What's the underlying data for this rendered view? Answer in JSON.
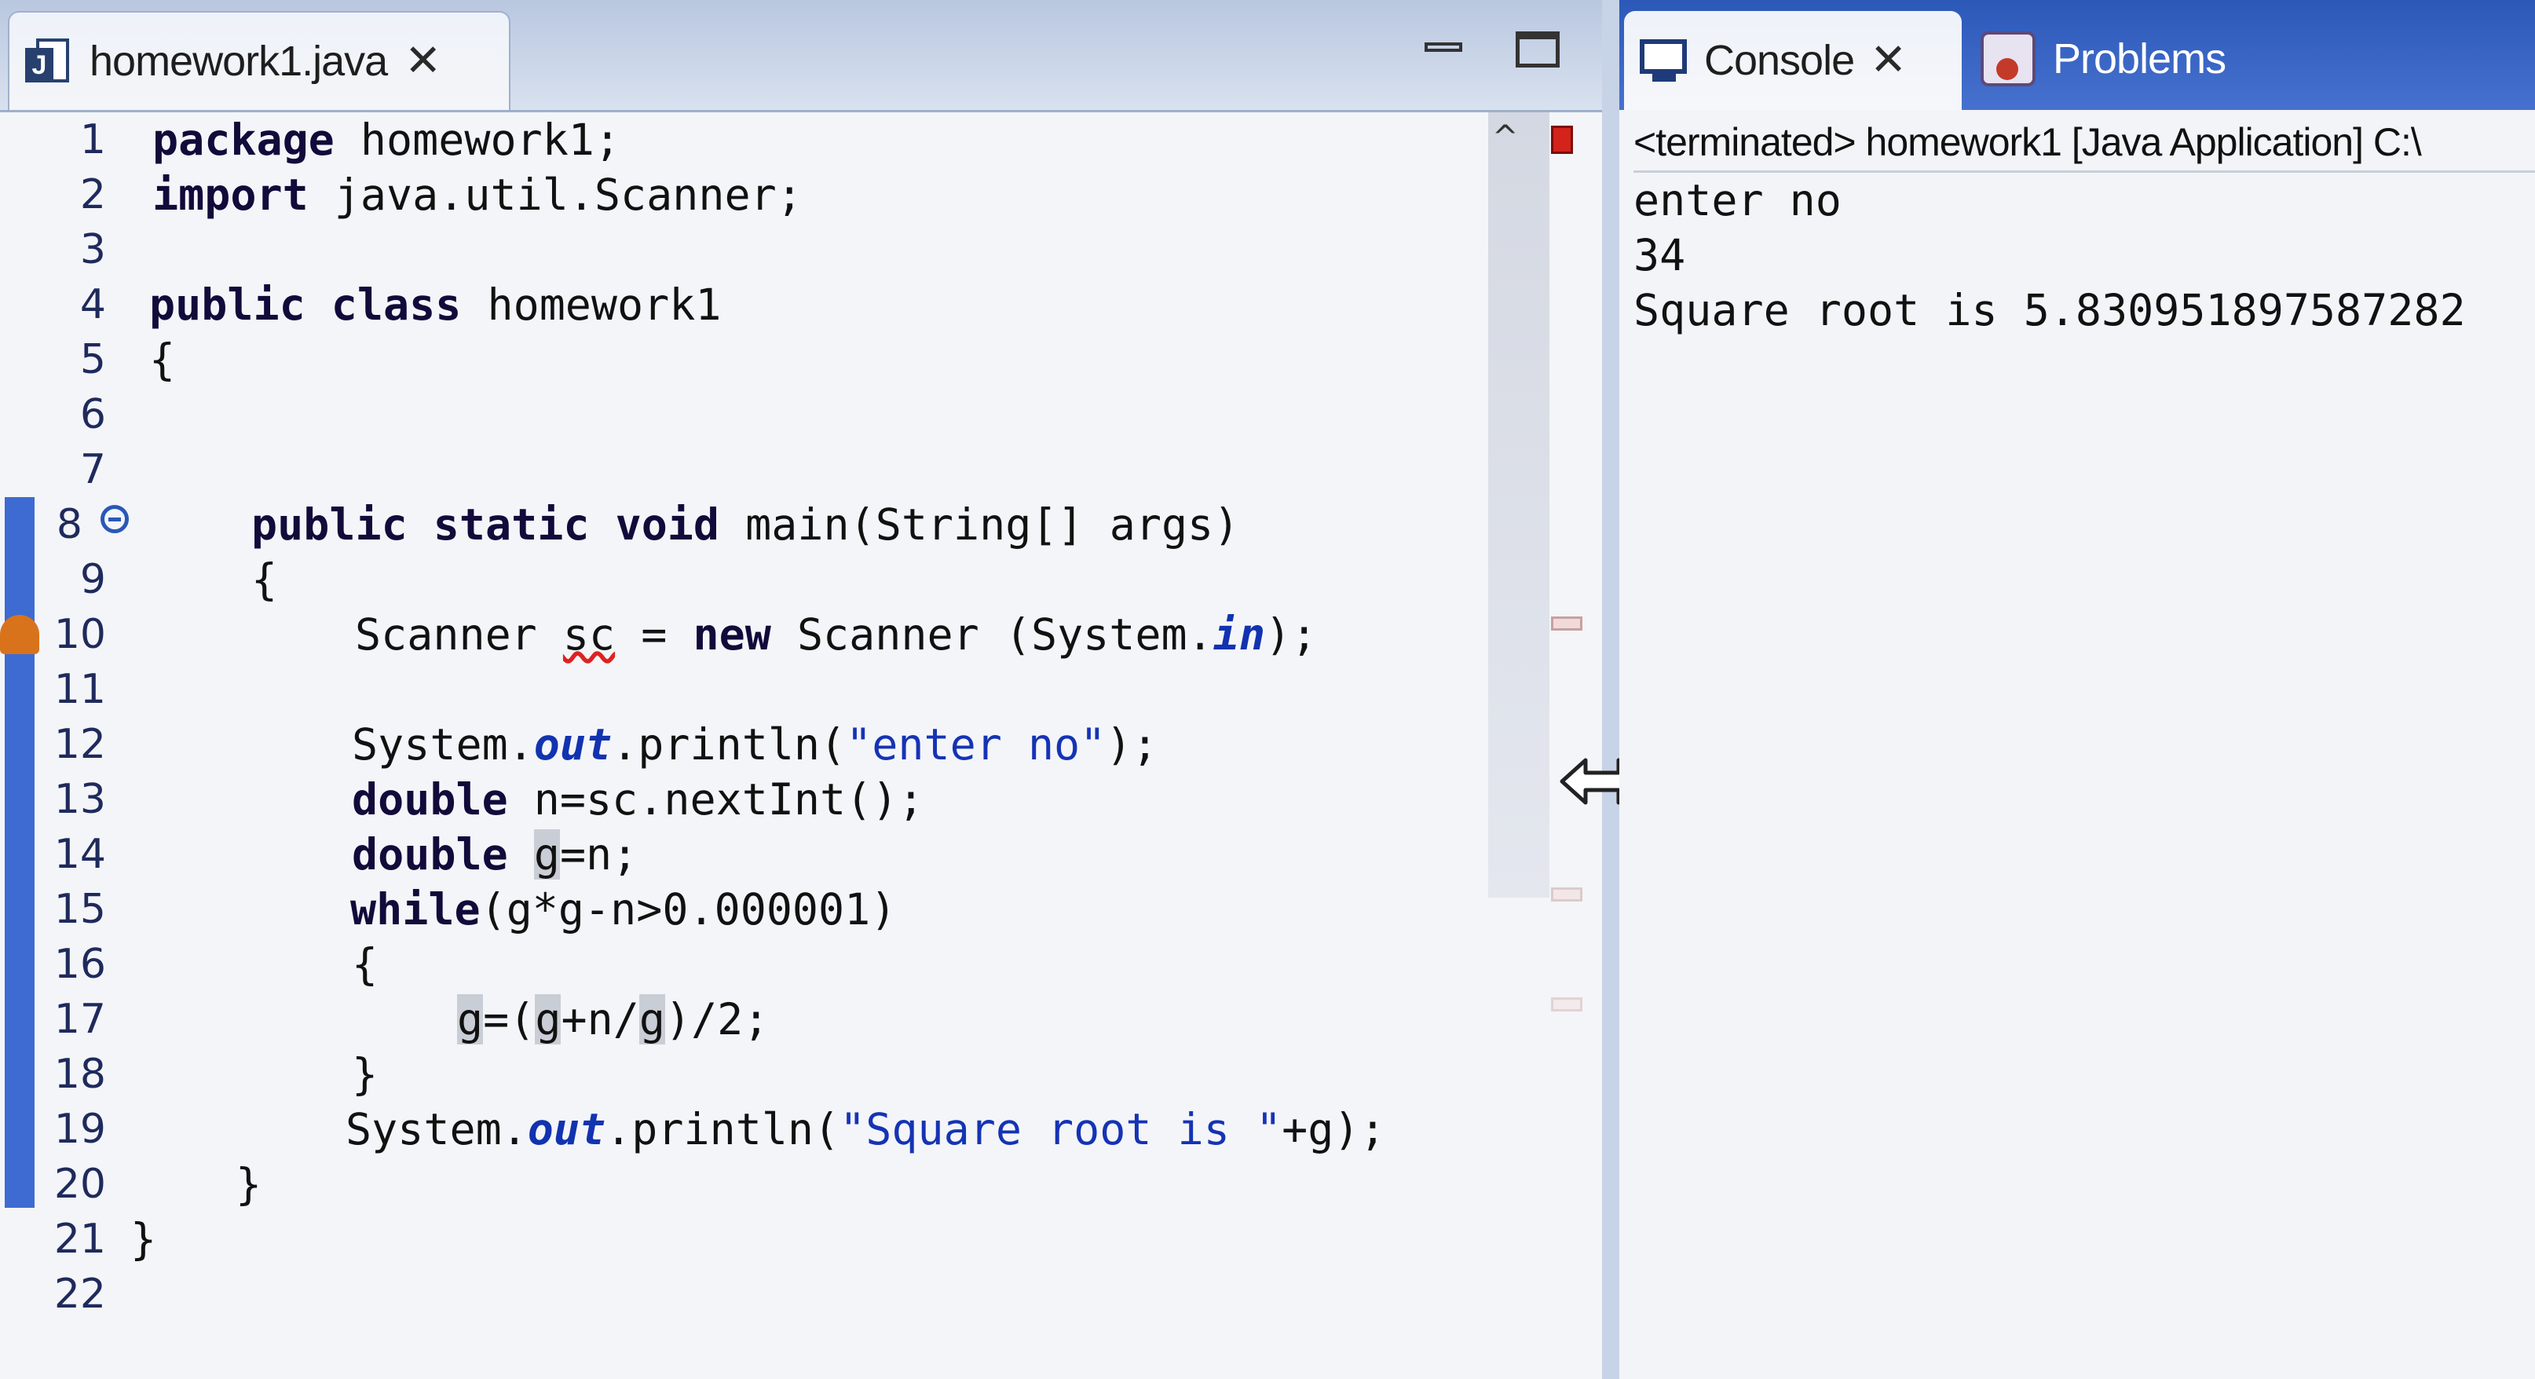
{
  "editor": {
    "tab_title": "homework1.java",
    "line_numbers": [
      "1",
      "2",
      "3",
      "4",
      "5",
      "6",
      "7",
      "8",
      "9",
      "10",
      "11",
      "12",
      "13",
      "14",
      "15",
      "16",
      "17",
      "18",
      "19",
      "20",
      "21",
      "22"
    ],
    "code": {
      "l1_kw": "package",
      "l1_rest": " homework1;",
      "l2_kw": "import",
      "l2_rest": " java.util.Scanner;",
      "l4_kw": "public class",
      "l4_rest": " homework1",
      "l5": "{",
      "l8_kw": "public static void",
      "l8_rest": " main(String[] args)",
      "l9": "{",
      "l10_a": "Scanner ",
      "l10_var": "sc",
      "l10_b": " = ",
      "l10_kw": "new",
      "l10_c": " Scanner (System.",
      "l10_fld": "in",
      "l10_d": ");",
      "l12_a": "System.",
      "l12_fld": "out",
      "l12_b": ".println(",
      "l12_str": "\"enter no\"",
      "l12_c": ");",
      "l13_kw": "double",
      "l13_rest": " n=sc.nextInt();",
      "l14_kw": "double",
      "l14_sp": " ",
      "l14_g": "g",
      "l14_rest": "=n;",
      "l15_kw": "while",
      "l15_rest": "(g*g-n>0.000001)",
      "l16": "{",
      "l17_g1": "g",
      "l17_a": "=(",
      "l17_g2": "g",
      "l17_b": "+n/",
      "l17_g3": "g",
      "l17_c": ")/2;",
      "l18": "}",
      "l19_a": "System.",
      "l19_fld": "out",
      "l19_b": ".println(",
      "l19_str": "\"Square root is \"",
      "l19_c": "+g);",
      "l20": "}",
      "l21": "}"
    }
  },
  "console": {
    "tab_title": "Console",
    "problems_tab_title": "Problems",
    "header": "<terminated> homework1 [Java Application] C:\\",
    "output": [
      "enter no",
      "34",
      "Square root is 5.830951897587282"
    ]
  }
}
